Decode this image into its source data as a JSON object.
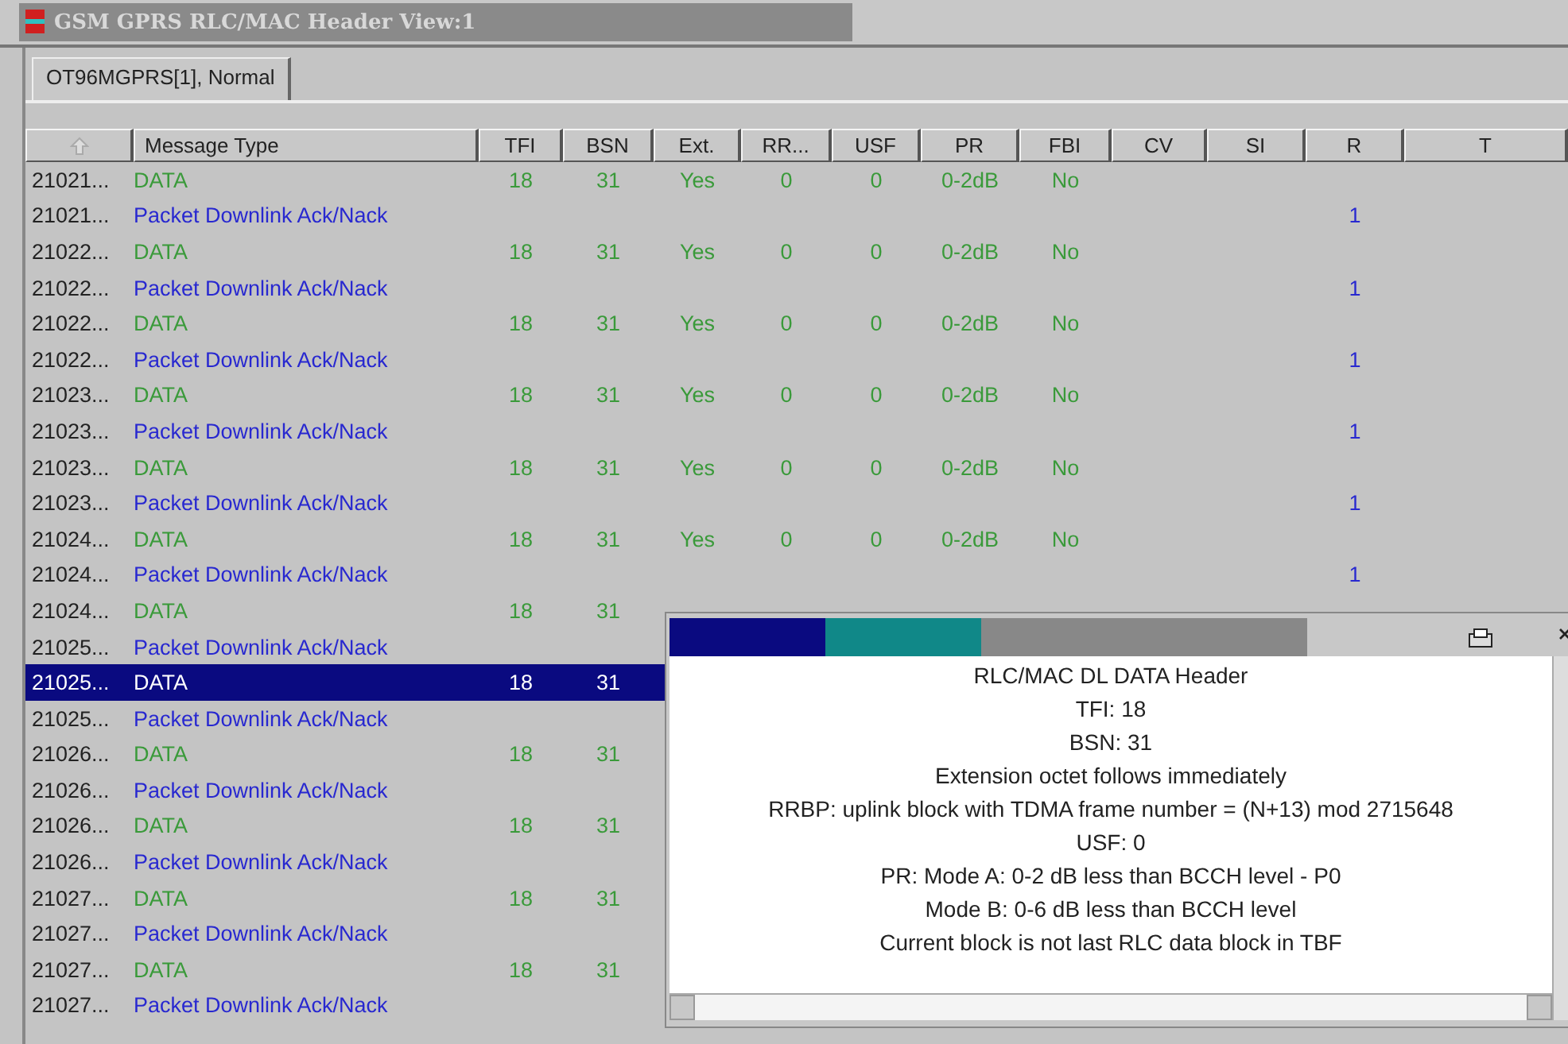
{
  "window": {
    "title": "GSM GPRS RLC/MAC Header View:1"
  },
  "tabs": [
    {
      "label": "OT96MGPRS[1], Normal",
      "selected": true
    }
  ],
  "table": {
    "columns": [
      "",
      "Message Type",
      "TFI",
      "BSN",
      "Ext.",
      "RR...",
      "USF",
      "PR",
      "FBI",
      "CV",
      "SI",
      "R",
      "T"
    ],
    "rows": [
      {
        "kind": "data",
        "cells": [
          "21021...",
          "DATA",
          "18",
          "31",
          "Yes",
          "0",
          "0",
          "0-2dB",
          "No",
          "",
          "",
          "",
          ""
        ],
        "selected": false
      },
      {
        "kind": "ack",
        "cells": [
          "21021...",
          "Packet Downlink Ack/Nack",
          "",
          "",
          "",
          "",
          "",
          "",
          "",
          "",
          "",
          "1",
          ""
        ],
        "selected": false
      },
      {
        "kind": "data",
        "cells": [
          "21022...",
          "DATA",
          "18",
          "31",
          "Yes",
          "0",
          "0",
          "0-2dB",
          "No",
          "",
          "",
          "",
          ""
        ],
        "selected": false
      },
      {
        "kind": "ack",
        "cells": [
          "21022...",
          "Packet Downlink Ack/Nack",
          "",
          "",
          "",
          "",
          "",
          "",
          "",
          "",
          "",
          "1",
          ""
        ],
        "selected": false
      },
      {
        "kind": "data",
        "cells": [
          "21022...",
          "DATA",
          "18",
          "31",
          "Yes",
          "0",
          "0",
          "0-2dB",
          "No",
          "",
          "",
          "",
          ""
        ],
        "selected": false
      },
      {
        "kind": "ack",
        "cells": [
          "21022...",
          "Packet Downlink Ack/Nack",
          "",
          "",
          "",
          "",
          "",
          "",
          "",
          "",
          "",
          "1",
          ""
        ],
        "selected": false
      },
      {
        "kind": "data",
        "cells": [
          "21023...",
          "DATA",
          "18",
          "31",
          "Yes",
          "0",
          "0",
          "0-2dB",
          "No",
          "",
          "",
          "",
          ""
        ],
        "selected": false
      },
      {
        "kind": "ack",
        "cells": [
          "21023...",
          "Packet Downlink Ack/Nack",
          "",
          "",
          "",
          "",
          "",
          "",
          "",
          "",
          "",
          "1",
          ""
        ],
        "selected": false
      },
      {
        "kind": "data",
        "cells": [
          "21023...",
          "DATA",
          "18",
          "31",
          "Yes",
          "0",
          "0",
          "0-2dB",
          "No",
          "",
          "",
          "",
          ""
        ],
        "selected": false
      },
      {
        "kind": "ack",
        "cells": [
          "21023...",
          "Packet Downlink Ack/Nack",
          "",
          "",
          "",
          "",
          "",
          "",
          "",
          "",
          "",
          "1",
          ""
        ],
        "selected": false
      },
      {
        "kind": "data",
        "cells": [
          "21024...",
          "DATA",
          "18",
          "31",
          "Yes",
          "0",
          "0",
          "0-2dB",
          "No",
          "",
          "",
          "",
          ""
        ],
        "selected": false
      },
      {
        "kind": "ack",
        "cells": [
          "21024...",
          "Packet Downlink Ack/Nack",
          "",
          "",
          "",
          "",
          "",
          "",
          "",
          "",
          "",
          "1",
          ""
        ],
        "selected": false
      },
      {
        "kind": "data",
        "cells": [
          "21024...",
          "DATA",
          "18",
          "31"
        ],
        "selected": false
      },
      {
        "kind": "ack",
        "cells": [
          "21025...",
          "Packet Downlink Ack/Nack"
        ],
        "selected": false
      },
      {
        "kind": "data",
        "cells": [
          "21025...",
          "DATA",
          "18",
          "31"
        ],
        "selected": true
      },
      {
        "kind": "ack",
        "cells": [
          "21025...",
          "Packet Downlink Ack/Nack"
        ],
        "selected": false
      },
      {
        "kind": "data",
        "cells": [
          "21026...",
          "DATA",
          "18",
          "31"
        ],
        "selected": false
      },
      {
        "kind": "ack",
        "cells": [
          "21026...",
          "Packet Downlink Ack/Nack"
        ],
        "selected": false
      },
      {
        "kind": "data",
        "cells": [
          "21026...",
          "DATA",
          "18",
          "31"
        ],
        "selected": false
      },
      {
        "kind": "ack",
        "cells": [
          "21026...",
          "Packet Downlink Ack/Nack"
        ],
        "selected": false
      },
      {
        "kind": "data",
        "cells": [
          "21027...",
          "DATA",
          "18",
          "31"
        ],
        "selected": false
      },
      {
        "kind": "ack",
        "cells": [
          "21027...",
          "Packet Downlink Ack/Nack"
        ],
        "selected": false
      },
      {
        "kind": "data",
        "cells": [
          "21027...",
          "DATA",
          "18",
          "31"
        ],
        "selected": false
      },
      {
        "kind": "ack",
        "cells": [
          "21027...",
          "Packet Downlink Ack/Nack"
        ],
        "selected": false
      }
    ]
  },
  "detail_popup": {
    "lines": [
      "RLC/MAC DL DATA Header",
      "TFI: 18",
      "BSN: 31",
      "Extension octet follows immediately",
      "RRBP: uplink block with TDMA frame number = (N+13) mod 2715648",
      "USF: 0",
      "PR: Mode A: 0-2 dB less than BCCH level - P0",
      "Mode B: 0-6 dB less than BCCH level",
      "Current block is not last RLC data block in TBF"
    ]
  }
}
